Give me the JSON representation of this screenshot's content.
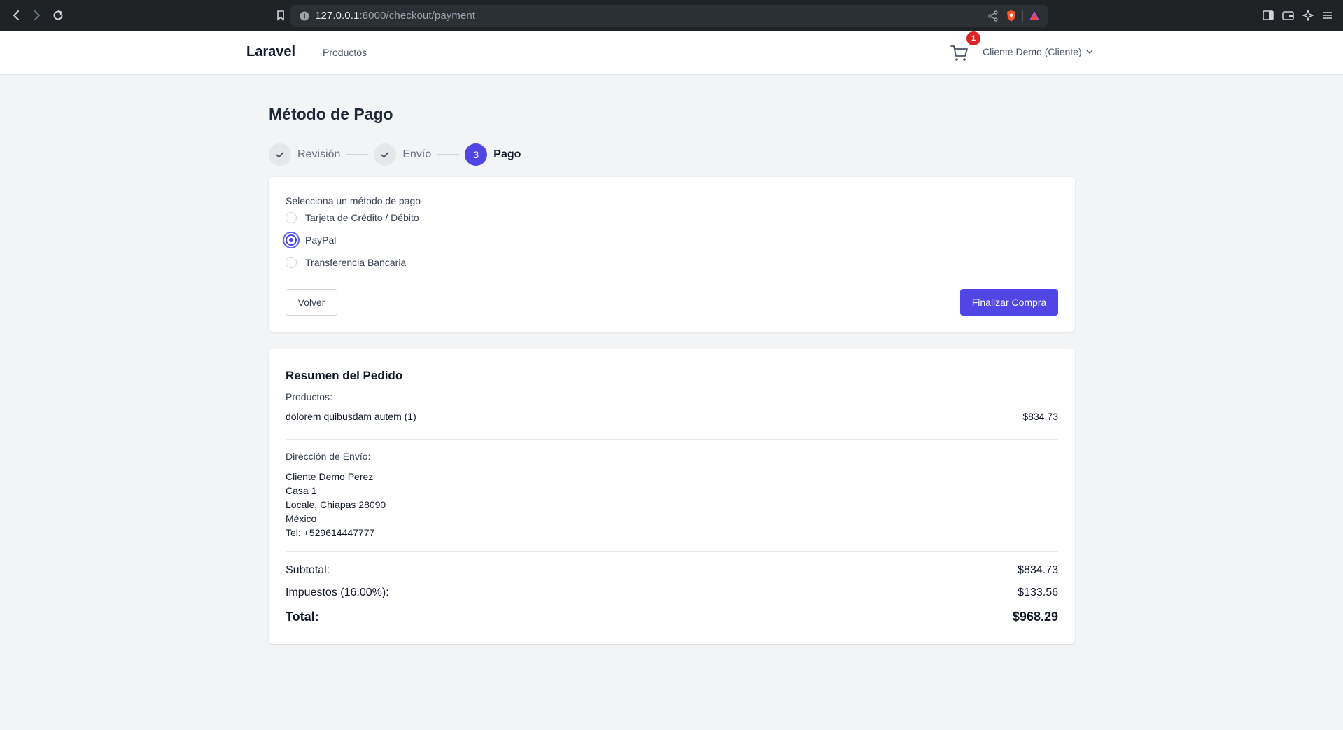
{
  "browser": {
    "url_host": "127.0.0.1",
    "url_rest": ":8000/checkout/payment"
  },
  "header": {
    "brand": "Laravel",
    "nav_link": "Productos",
    "cart_count": "1",
    "user_label": "Cliente Demo (Cliente)"
  },
  "page": {
    "title": "Método de Pago"
  },
  "steps": [
    {
      "label": "Revisión",
      "state": "done"
    },
    {
      "label": "Envío",
      "state": "done"
    },
    {
      "label": "Pago",
      "number": "3",
      "state": "active"
    }
  ],
  "payment": {
    "prompt": "Selecciona un método de pago",
    "options": [
      {
        "label": "Tarjeta de Crédito / Débito",
        "checked": false
      },
      {
        "label": "PayPal",
        "checked": true
      },
      {
        "label": "Transferencia Bancaria",
        "checked": false
      }
    ],
    "back_label": "Volver",
    "submit_label": "Finalizar Compra"
  },
  "summary": {
    "title": "Resumen del Pedido",
    "products_label": "Productos:",
    "items": [
      {
        "name": "dolorem quibusdam autem (1)",
        "price": "$834.73"
      }
    ],
    "address_label": "Dirección de Envío:",
    "address": {
      "name": "Cliente Demo Perez",
      "line1": "Casa 1",
      "line2": "Locale, Chiapas 28090",
      "country": "México",
      "phone": "Tel: +529614447777"
    },
    "subtotal_label": "Subtotal:",
    "subtotal": "$834.73",
    "tax_label": "Impuestos (16.00%):",
    "tax": "$133.56",
    "total_label": "Total:",
    "total": "$968.29"
  },
  "colors": {
    "accent": "#4f46e5",
    "badge": "#dc2626",
    "chrome": "#1f2326"
  }
}
